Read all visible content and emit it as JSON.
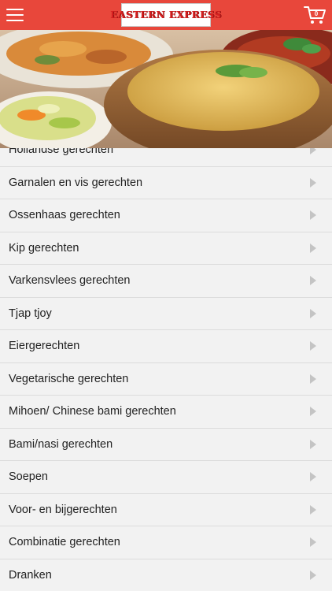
{
  "header": {
    "logo_text": "EASTERN EXPRESS",
    "cart_count": "0",
    "menu_icon": "hamburger-icon",
    "cart_icon": "shopping-cart-icon",
    "bar_color": "#e8473b"
  },
  "hero": {
    "image": "food-banner-rice-dishes"
  },
  "menu": {
    "items": [
      {
        "label": "Hollandse gerechten"
      },
      {
        "label": "Garnalen en vis gerechten"
      },
      {
        "label": "Ossenhaas gerechten"
      },
      {
        "label": "Kip gerechten"
      },
      {
        "label": "Varkensvlees gerechten"
      },
      {
        "label": "Tjap tjoy"
      },
      {
        "label": "Eiergerechten"
      },
      {
        "label": "Vegetarische gerechten"
      },
      {
        "label": "Mihoen/ Chinese bami gerechten"
      },
      {
        "label": "Bami/nasi gerechten"
      },
      {
        "label": "Soepen"
      },
      {
        "label": "Voor- en bijgerechten"
      },
      {
        "label": "Combinatie gerechten"
      },
      {
        "label": "Dranken"
      }
    ]
  }
}
